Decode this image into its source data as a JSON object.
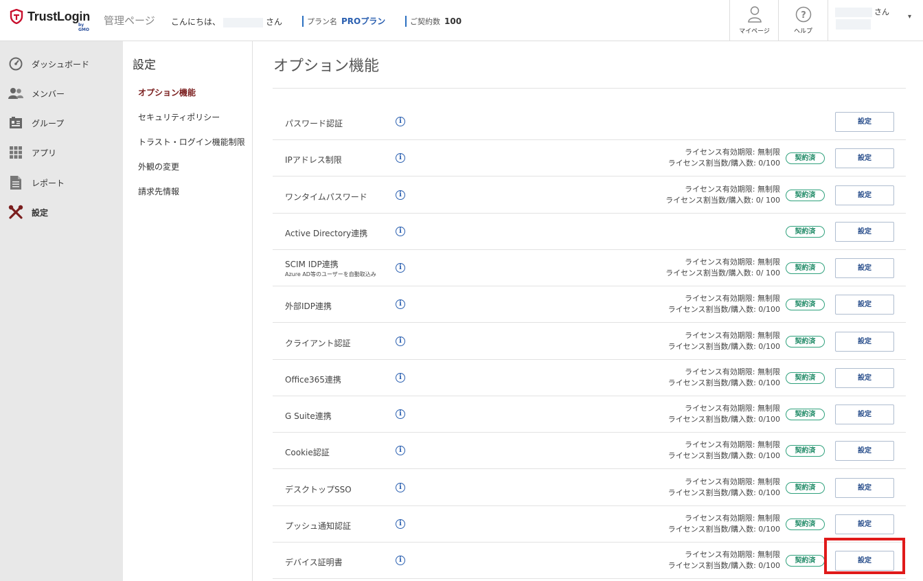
{
  "header": {
    "brand": "TrustLogin",
    "brand_sub": "by GMO",
    "admin_title": "管理ページ",
    "greet_prefix": "こんにちは、",
    "greet_suffix": "さん",
    "plan_label": "プラン名",
    "plan_value": "PROプラン",
    "contracts_label": "ご契約数",
    "contracts_value": "100",
    "mypage_label": "マイページ",
    "help_label": "ヘルプ",
    "user_suffix": "さん",
    "user_caret": "▾"
  },
  "sidebar": {
    "items": [
      {
        "label": "ダッシュボード",
        "icon": "dashboard-icon"
      },
      {
        "label": "メンバー",
        "icon": "members-icon"
      },
      {
        "label": "グループ",
        "icon": "group-icon"
      },
      {
        "label": "アプリ",
        "icon": "apps-icon"
      },
      {
        "label": "レポート",
        "icon": "report-icon"
      },
      {
        "label": "設定",
        "icon": "settings-tools-icon"
      }
    ]
  },
  "subnav": {
    "title": "設定",
    "items": [
      "オプション機能",
      "セキュリティポリシー",
      "トラスト・ログイン機能制限",
      "外観の変更",
      "請求先情報"
    ]
  },
  "main": {
    "title": "オプション機能",
    "badge_label": "契約済",
    "button_label": "設定",
    "info_glyph": "i",
    "rows": [
      {
        "name": "パスワード認証"
      },
      {
        "name": "IPアドレス制限",
        "lic1": "ライセンス有効期限: 無制限",
        "lic2": "ライセンス割当数/購入数: 0/100"
      },
      {
        "name": "ワンタイムパスワード",
        "lic1": "ライセンス有効期限: 無制限",
        "lic2": "ライセンス割当数/購入数: 0/ 100"
      },
      {
        "name": "Active Directory連携"
      },
      {
        "name": "SCIM IDP連携",
        "sub": "Azure AD等のユーザーを自動取込み",
        "lic1": "ライセンス有効期限: 無制限",
        "lic2": "ライセンス割当数/購入数: 0/ 100"
      },
      {
        "name": "外部IDP連携",
        "lic1": "ライセンス有効期限: 無制限",
        "lic2": "ライセンス割当数/購入数: 0/100"
      },
      {
        "name": "クライアント認証",
        "lic1": "ライセンス有効期限: 無制限",
        "lic2": "ライセンス割当数/購入数: 0/100"
      },
      {
        "name": "Office365連携",
        "lic1": "ライセンス有効期限: 無制限",
        "lic2": "ライセンス割当数/購入数: 0/100"
      },
      {
        "name": "G Suite連携",
        "lic1": "ライセンス有効期限: 無制限",
        "lic2": "ライセンス割当数/購入数: 0/100"
      },
      {
        "name": "Cookie認証",
        "lic1": "ライセンス有効期限: 無制限",
        "lic2": "ライセンス割当数/購入数: 0/100"
      },
      {
        "name": "デスクトップSSO",
        "lic1": "ライセンス有効期限: 無制限",
        "lic2": "ライセンス割当数/購入数: 0/100"
      },
      {
        "name": "プッシュ通知認証",
        "lic1": "ライセンス有効期限: 無制限",
        "lic2": "ライセンス割当数/購入数: 0/100"
      },
      {
        "name": "デバイス証明書",
        "lic1": "ライセンス有効期限: 無制限",
        "lic2": "ライセンス割当数/購入数: 0/100"
      }
    ]
  },
  "colors": {
    "accent_blue": "#2a5fb0",
    "badge_green": "#2fa17c",
    "active_red": "#7a1e1e",
    "highlight_red": "#e01a1a"
  }
}
